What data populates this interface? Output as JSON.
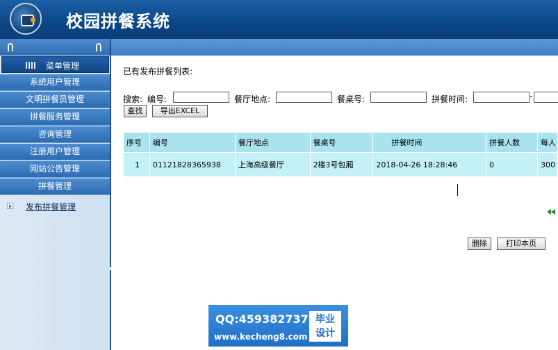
{
  "app": {
    "title": "校园拼餐系统"
  },
  "sidebar": {
    "header_label": "菜单管理",
    "items": [
      {
        "label": "系统用户管理"
      },
      {
        "label": "文明拼餐员管理"
      },
      {
        "label": "拼餐服务管理"
      },
      {
        "label": "咨询管理"
      },
      {
        "label": "注册用户管理"
      },
      {
        "label": "网站公告管理"
      },
      {
        "label": "拼餐管理"
      }
    ],
    "sub_item": {
      "label": "发布拼餐管理"
    }
  },
  "main": {
    "list_title": "已有发布拼餐列表:",
    "search": {
      "prefix": "搜索:",
      "number_label": "编号:",
      "location_label": "餐厅地点:",
      "table_label": "餐桌号:",
      "time_label": "拼餐时间:",
      "time_separator": "-",
      "search_button": "查找",
      "export_button": "导出EXCEL"
    },
    "table": {
      "headers": [
        "序号",
        "编号",
        "餐厅地点",
        "餐桌号",
        "拼餐时间",
        "拼餐人数",
        "每人"
      ],
      "rows": [
        [
          "1",
          "01121828365938",
          "上海高级餐厅",
          "2楼3号包厢",
          "2018-04-26 18:28:46",
          "0",
          "300"
        ]
      ]
    },
    "actions": {
      "delete": "删除",
      "print": "打印本页"
    }
  },
  "watermark": {
    "qq": "QQ:459382737",
    "url": "www.kecheng8.com",
    "badge_line1": "毕业",
    "badge_line2": "设计"
  },
  "colors": {
    "header_bg": "#0b4686",
    "menu_bg": "#2d6cb1",
    "table_bg": "#c2f0f6"
  }
}
